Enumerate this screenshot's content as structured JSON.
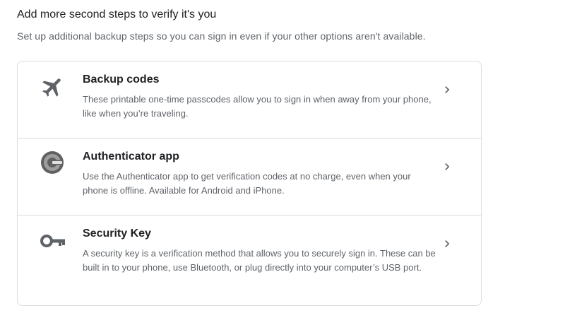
{
  "section": {
    "title": "Add more second steps to verify it's you",
    "description": "Set up additional backup steps so you can sign in even if your other options aren't available."
  },
  "options": [
    {
      "title": "Backup codes",
      "description": "These printable one-time passcodes allow you to sign in when away from your phone, like when you’re traveling.",
      "icon": "airplane-icon"
    },
    {
      "title": "Authenticator app",
      "description": "Use the Authenticator app to get verification codes at no charge, even when your phone is offline. Available for Android and iPhone.",
      "icon": "authenticator-icon"
    },
    {
      "title": "Security Key",
      "description": "A security key is a verification method that allows you to securely sign in. These can be built in to your phone, use Bluetooth, or plug directly into your computer’s USB port.",
      "icon": "key-icon"
    }
  ],
  "colors": {
    "icon": "#5f6368",
    "border": "#dadce0",
    "text_primary": "#202124",
    "text_secondary": "#5f6368"
  }
}
